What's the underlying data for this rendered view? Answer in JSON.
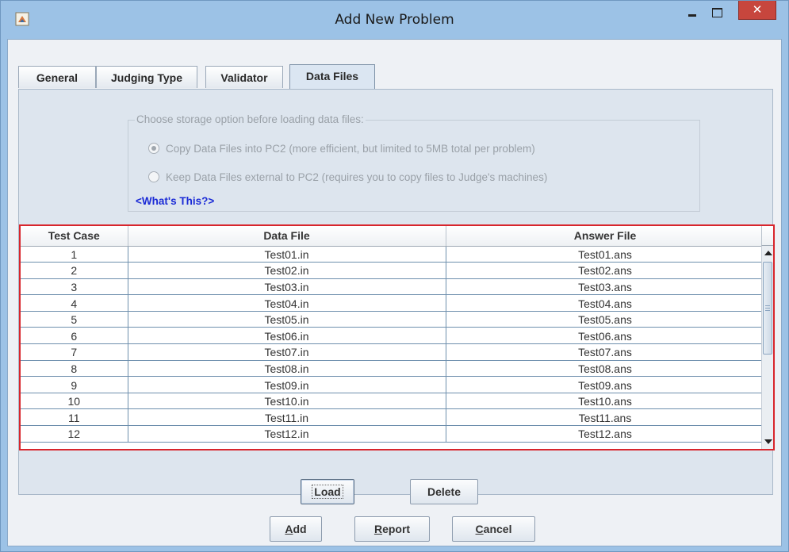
{
  "window": {
    "title": "Add New Problem",
    "close_glyph": "✕"
  },
  "tabs": [
    {
      "label": "General"
    },
    {
      "label": "Judging Type"
    },
    {
      "label": "Validator"
    },
    {
      "label": "Data Files",
      "active": true
    }
  ],
  "storage": {
    "group_title": "Choose storage option before loading data files:",
    "option_copy": "Copy Data Files into PC2 (more efficient, but limited to 5MB total per problem)",
    "option_copy_selected": true,
    "option_external": "Keep Data Files external to PC2 (requires you to copy files to Judge's machines)",
    "option_external_selected": false,
    "whats_this": "<What's This?>"
  },
  "table": {
    "headers": [
      "Test Case",
      "Data File",
      "Answer File"
    ],
    "rows": [
      [
        "1",
        "Test01.in",
        "Test01.ans"
      ],
      [
        "2",
        "Test02.in",
        "Test02.ans"
      ],
      [
        "3",
        "Test03.in",
        "Test03.ans"
      ],
      [
        "4",
        "Test04.in",
        "Test04.ans"
      ],
      [
        "5",
        "Test05.in",
        "Test05.ans"
      ],
      [
        "6",
        "Test06.in",
        "Test06.ans"
      ],
      [
        "7",
        "Test07.in",
        "Test07.ans"
      ],
      [
        "8",
        "Test08.in",
        "Test08.ans"
      ],
      [
        "9",
        "Test09.in",
        "Test09.ans"
      ],
      [
        "10",
        "Test10.in",
        "Test10.ans"
      ],
      [
        "11",
        "Test11.in",
        "Test11.ans"
      ],
      [
        "12",
        "Test12.in",
        "Test12.ans"
      ]
    ]
  },
  "datafile_buttons": {
    "load_label": "Load",
    "delete_label": "Delete"
  },
  "dialog_buttons": {
    "add_mnemonic": "A",
    "add_rest": "dd",
    "report_mnemonic": "R",
    "report_rest": "eport",
    "cancel_mnemonic": "C",
    "cancel_rest": "ancel"
  },
  "colors": {
    "title_bar": "#9cc2e6",
    "close_button": "#c7463d",
    "table_highlight_border": "#d8252c",
    "link": "#1b2bd6"
  },
  "icons": [
    "app-icon",
    "minimize-icon",
    "maximize-icon",
    "close-icon",
    "radio-selected-icon",
    "radio-unselected-icon",
    "scroll-up-arrow-icon",
    "scroll-down-arrow-icon"
  ]
}
